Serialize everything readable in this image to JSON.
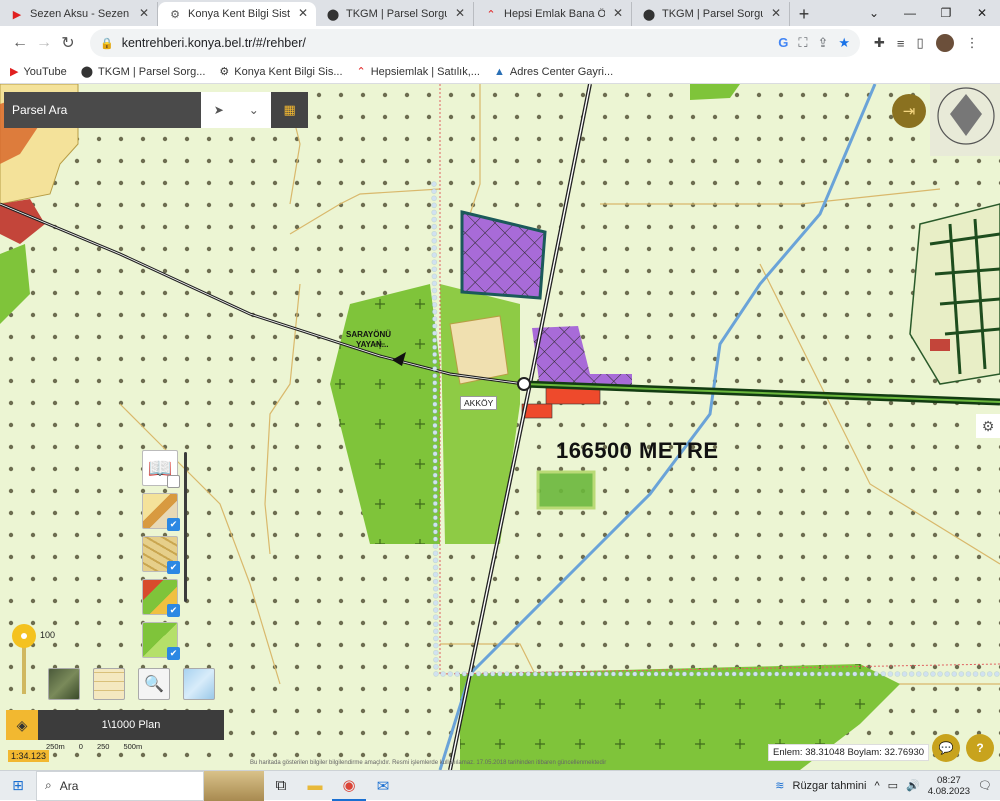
{
  "browser": {
    "tabs": [
      {
        "label": "Sezen Aksu - Sezen A",
        "icon": "youtube-icon",
        "active": false
      },
      {
        "label": "Konya Kent Bilgi Sistemi",
        "icon": "kbs-icon",
        "active": true
      },
      {
        "label": "TKGM | Parsel Sorgu Uyg",
        "icon": "map-pin-icon",
        "active": false
      },
      {
        "label": "Hepsi Emlak Bana Özel",
        "icon": "hepsiemlak-icon",
        "active": false
      },
      {
        "label": "TKGM | Parsel Sorgu Uyg",
        "icon": "map-pin-icon",
        "active": false
      }
    ],
    "url": "kentrehberi.konya.bel.tr/#/rehber/",
    "bookmarks": [
      {
        "label": "YouTube",
        "icon": "youtube-icon"
      },
      {
        "label": "TKGM | Parsel Sorg...",
        "icon": "map-pin-icon"
      },
      {
        "label": "Konya Kent Bilgi Sis...",
        "icon": "kbs-icon"
      },
      {
        "label": "Hepsiemlak | Satılık,...",
        "icon": "hepsiemlak-icon"
      },
      {
        "label": "Adres Center Gayri...",
        "icon": "adres-icon"
      }
    ]
  },
  "map": {
    "parcel_search_title": "Parsel Ara",
    "labels": {
      "big_distance": "166500 METRE",
      "akkoy": "AKKÖY",
      "road_line1": "SARAYÖNÜ",
      "road_line2": "YAYAN..."
    },
    "opacity_value": "100",
    "plan_label": "1\\1000 Plan",
    "scale_ratio": "1:34.123",
    "scale_ticks": [
      "250m",
      "0",
      "250",
      "500m"
    ],
    "coordinates": "Enlem: 38.31048 Boylam: 32.76930",
    "disclaimer": "Bu haritada gösterilen bilgiler bilgilendirme amaçlıdır. Resmi işlemlerde kullanılamaz. 17.05.2018 tarihinden itibaren güncellenmektedir",
    "layers": [
      {
        "name": "layer-book",
        "checked": false
      },
      {
        "name": "layer-imar",
        "checked": true
      },
      {
        "name": "layer-parcel",
        "checked": true
      },
      {
        "name": "layer-zoning",
        "checked": true
      },
      {
        "name": "layer-green",
        "checked": true
      }
    ],
    "colors": {
      "background": "#ecf5d3",
      "agri_green": "#7fc43a",
      "purple": "#a86bd8",
      "red": "#ee4a2c",
      "accent_yellow": "#f2b830"
    }
  },
  "taskbar": {
    "search_placeholder": "Ara",
    "weather": "Rüzgar tahmini",
    "time": "08:27",
    "date": "4.08.2023"
  }
}
